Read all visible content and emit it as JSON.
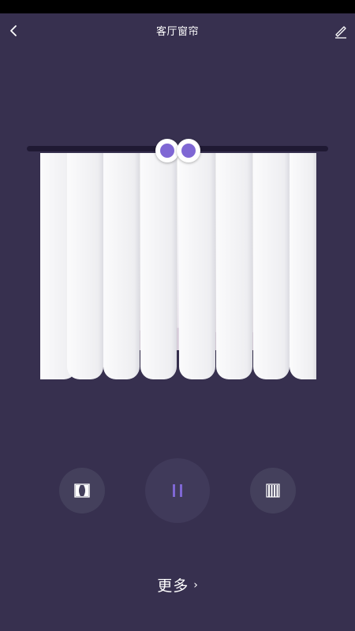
{
  "header": {
    "title": "客厅窗帘"
  },
  "icons": {
    "back": "chevron-left-icon",
    "edit": "pencil-icon",
    "open": "curtain-open-icon",
    "pause": "pause-icon",
    "close": "curtain-closed-icon"
  },
  "curtain": {
    "open_fraction": 0
  },
  "footer": {
    "more_label": "更多",
    "more_arrow": "›"
  },
  "colors": {
    "background": "#37304f",
    "accent": "#7f67d4",
    "rail": "#1f1933",
    "button_bg": "#44405c"
  }
}
